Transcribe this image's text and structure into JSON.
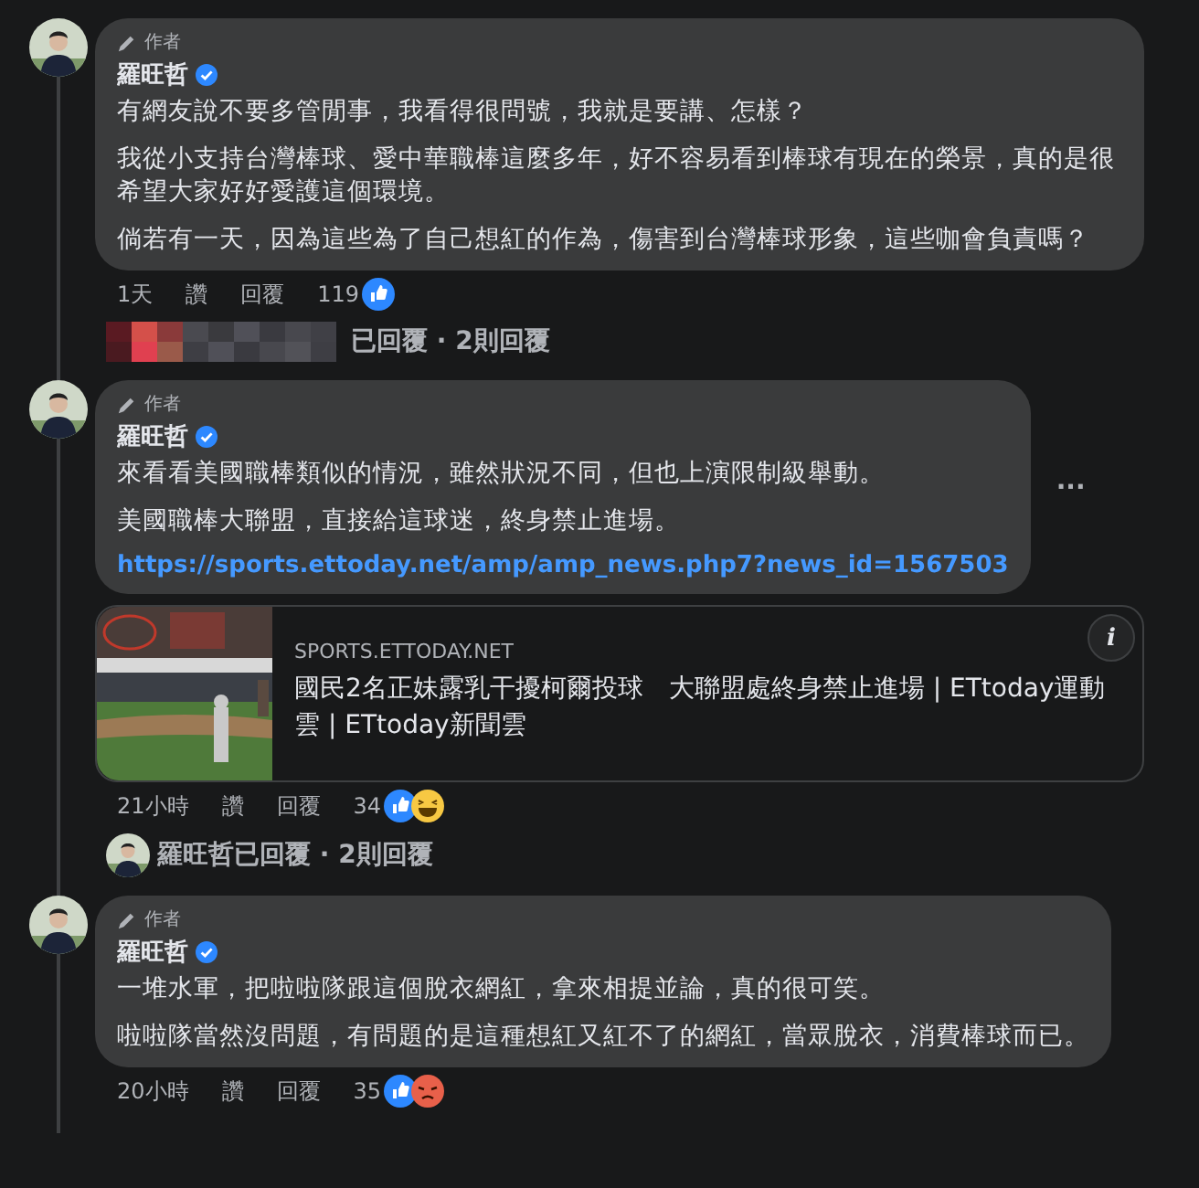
{
  "comments": [
    {
      "badge": "作者",
      "author": "羅旺哲",
      "verified": true,
      "paragraphs": [
        "有網友說不要多管閒事，我看得很問號，我就是要講、怎樣？",
        "我從小支持台灣棒球、愛中華職棒這麼多年，好不容易看到棒球有現在的榮景，真的是很希望大家好好愛護這個環境。",
        "倘若有一天，因為這些為了自己想紅的作為，傷害到台灣棒球形象，這些咖會負責嗎？"
      ],
      "time": "1天",
      "like_label": "讚",
      "reply_label": "回覆",
      "count": "119",
      "reactions": [
        {
          "kind": "like"
        }
      ],
      "replies": {
        "kind": "blurred",
        "text": "已回覆 · 2則回覆"
      }
    },
    {
      "badge": "作者",
      "author": "羅旺哲",
      "verified": true,
      "paragraphs": [
        "來看看美國職棒類似的情況，雖然狀況不同，但也上演限制級舉動。",
        "美國職棒大聯盟，直接給這球迷，終身禁止進場。"
      ],
      "link": "https://sports.ettoday.net/amp/amp_news.php7?news_id=1567503",
      "more": "···",
      "preview": {
        "domain": "SPORTS.ETTODAY.NET",
        "title": "國民2名正妹露乳干擾柯爾投球　大聯盟處終身禁止進場 | ETtoday運動雲 | ETtoday新聞雲",
        "info": "i"
      },
      "time": "21小時",
      "like_label": "讚",
      "reply_label": "回覆",
      "count": "34",
      "reactions": [
        {
          "kind": "like"
        },
        {
          "kind": "haha"
        }
      ],
      "replies": {
        "kind": "avatar",
        "text": "羅旺哲已回覆 · 2則回覆"
      }
    },
    {
      "badge": "作者",
      "author": "羅旺哲",
      "verified": true,
      "paragraphs": [
        "一堆水軍，把啦啦隊跟這個脫衣網紅，拿來相提並論，真的很可笑。",
        "啦啦隊當然沒問題，有問題的是這種想紅又紅不了的網紅，當眾脫衣，消費棒球而已。"
      ],
      "time": "20小時",
      "like_label": "讚",
      "reply_label": "回覆",
      "count": "35",
      "reactions": [
        {
          "kind": "like"
        },
        {
          "kind": "angry"
        }
      ]
    }
  ]
}
